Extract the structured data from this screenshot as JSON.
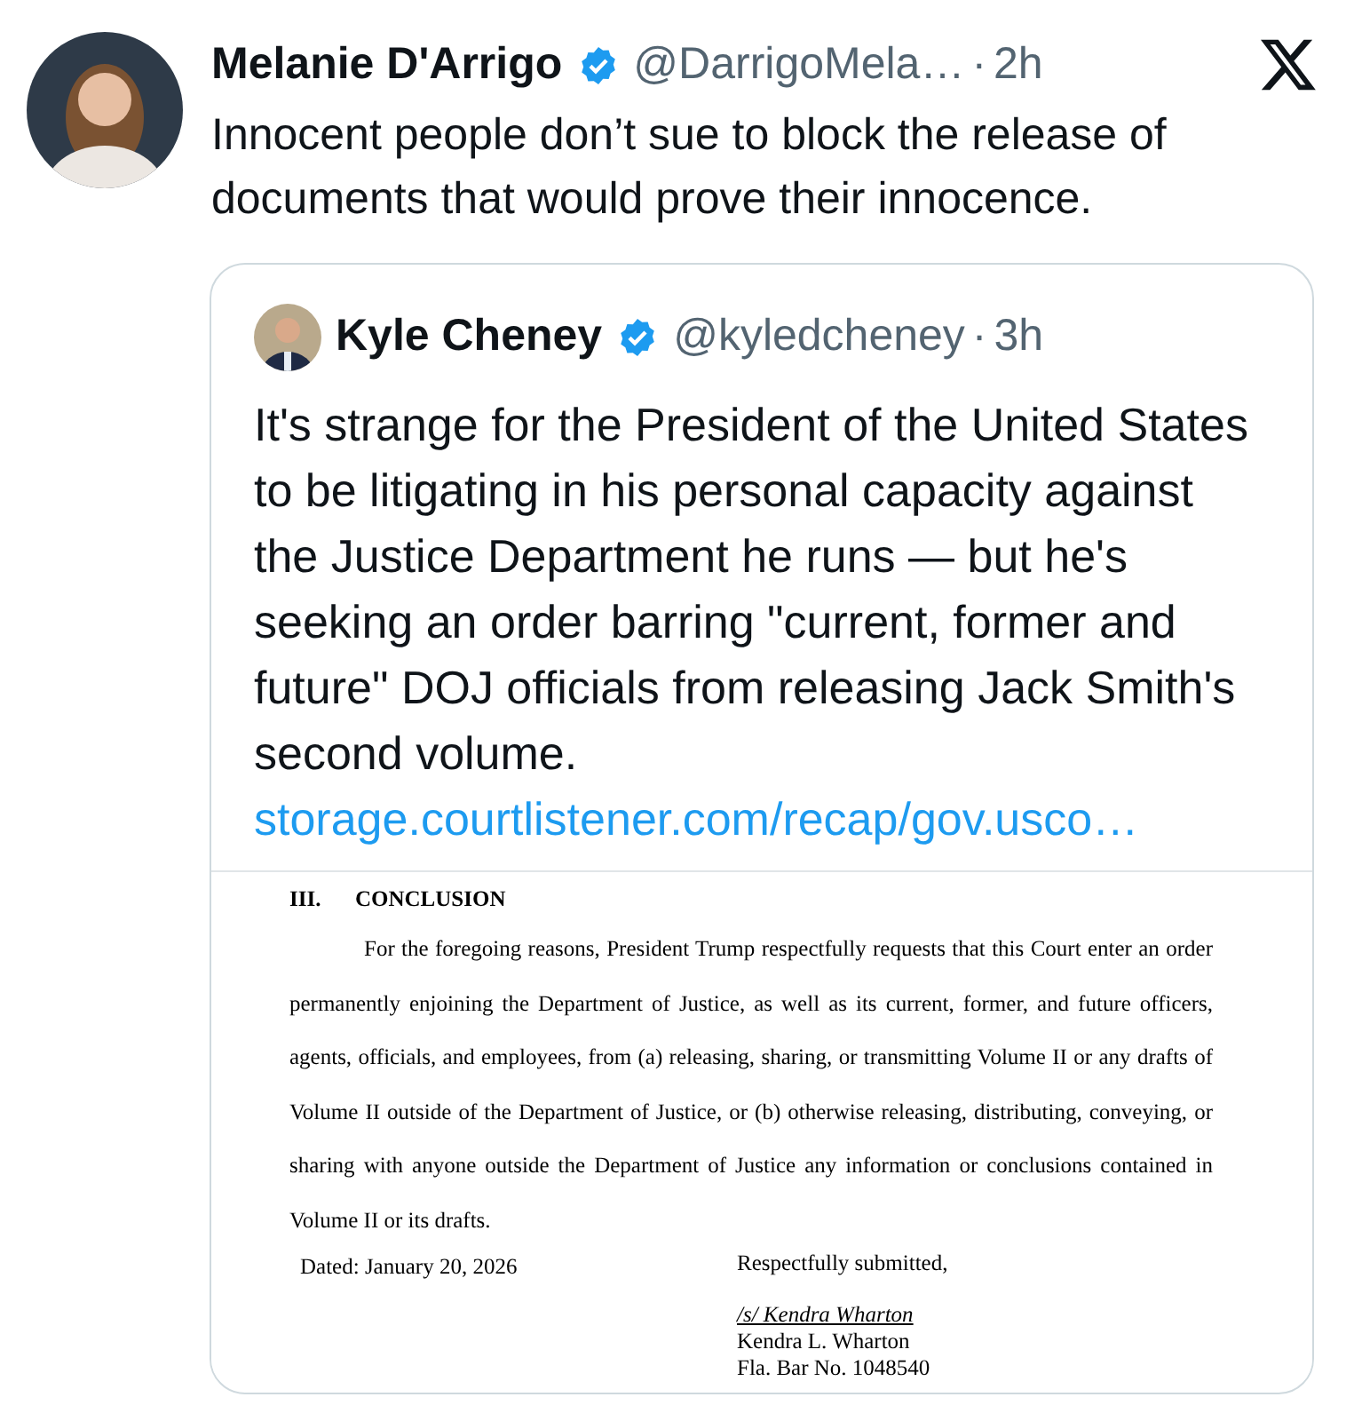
{
  "tweet": {
    "author": {
      "name": "Melanie D'Arrigo",
      "verified": true,
      "handle": "@DarrigoMela…",
      "separator": "·",
      "time": "2h"
    },
    "text": "Innocent people don’t sue to block the release of documents that would prove their innocence.",
    "quote": {
      "author": {
        "name": "Kyle Cheney",
        "verified": true,
        "handle": "@kyledcheney",
        "separator": "·",
        "time": "3h"
      },
      "text": "It's strange for the President of the United States to be litigating in his personal capacity against the Justice Department he runs — but he's seeking an order barring \"current, former and future\" DOJ officials from releasing Jack Smith's second volume.",
      "link": "storage.courtlistener.com/recap/gov.usco…",
      "document": {
        "section_number": "III.",
        "section_title": "CONCLUSION",
        "paragraph": "For the foregoing reasons, President Trump respectfully requests that this Court enter an order permanently enjoining the Department of Justice, as well as its current, former, and future officers, agents, officials, and employees, from (a) releasing, sharing, or transmitting Volume II or any drafts of Volume II outside of the Department of Justice, or (b) otherwise releasing, distributing, conveying, or sharing with anyone outside the Department of Justice any information or conclusions contained in Volume II or its drafts.",
        "dated": "Dated: January 20, 2026",
        "closing": "Respectfully submitted,",
        "signature": "/s/ Kendra Wharton",
        "signer": "Kendra L. Wharton",
        "bar_number": "Fla. Bar No. 1048540"
      }
    }
  }
}
